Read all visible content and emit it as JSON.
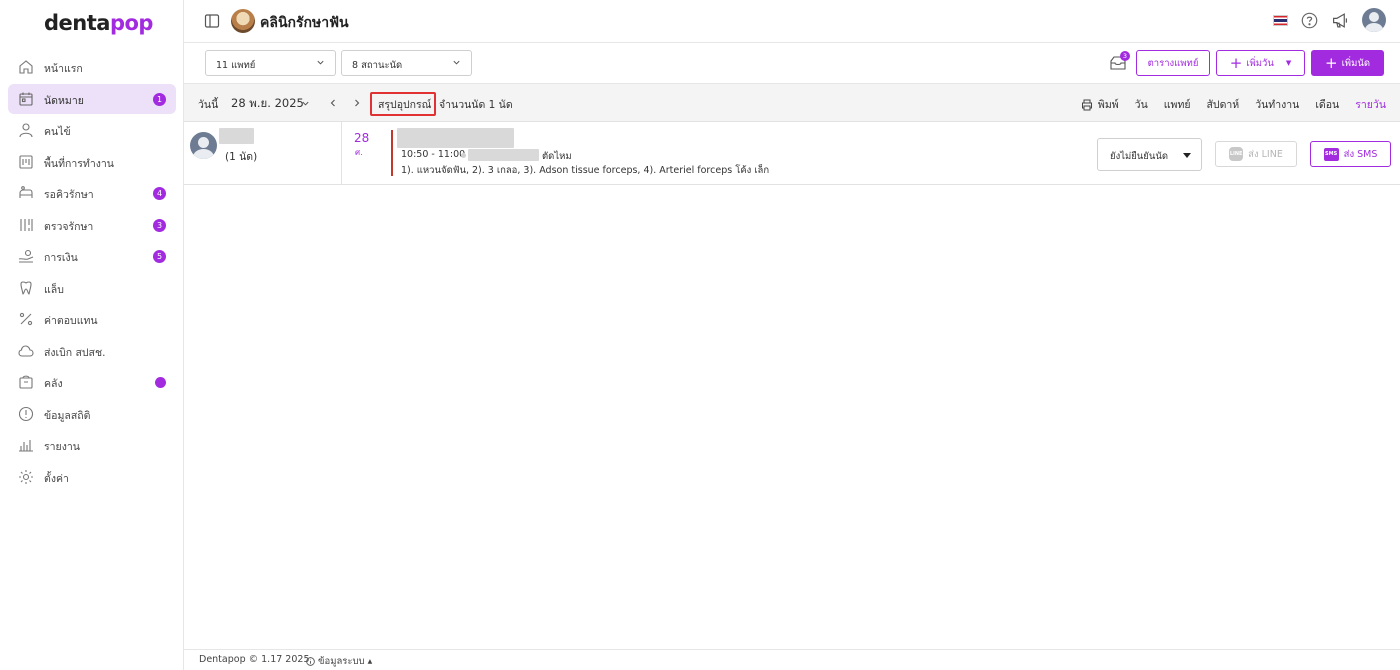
{
  "brand": {
    "logo_main": "denta",
    "logo_accent": "pop",
    "accent_color": "#a22be0"
  },
  "sidebar": {
    "items": [
      {
        "label": "หน้าแรก",
        "icon": "home-icon",
        "active": false
      },
      {
        "label": "นัดหมาย",
        "icon": "calendar-icon",
        "active": true,
        "badge": "1"
      },
      {
        "label": "คนไข้",
        "icon": "user-icon",
        "active": false
      },
      {
        "label": "พื้นที่การทำงาน",
        "icon": "workspace-icon",
        "active": false
      },
      {
        "label": "รอคิวรักษา",
        "icon": "queue-icon",
        "active": false,
        "badge": "4"
      },
      {
        "label": "ตรวจรักษา",
        "icon": "treatment-icon",
        "active": false,
        "badge": "3"
      },
      {
        "label": "การเงิน",
        "icon": "finance-icon",
        "active": false,
        "badge": "5"
      },
      {
        "label": "แล็บ",
        "icon": "tooth-icon",
        "active": false
      },
      {
        "label": "ค่าตอบแทน",
        "icon": "percent-icon",
        "active": false
      },
      {
        "label": "ส่งเบิก สปสช.",
        "icon": "cloud-icon",
        "active": false
      },
      {
        "label": "คลัง",
        "icon": "inventory-icon",
        "active": false,
        "dot": true
      },
      {
        "label": "ข้อมูลสถิติ",
        "icon": "statistics-icon",
        "active": false
      },
      {
        "label": "รายงาน",
        "icon": "report-icon",
        "active": false
      },
      {
        "label": "ตั้งค่า",
        "icon": "gear-icon",
        "active": false
      }
    ]
  },
  "header": {
    "clinic_name": "คลินิกรักษาฟัน"
  },
  "filters": {
    "doctor_select": "11 แพทย์",
    "location_select": "8 สถานะนัด",
    "inbox_count": "3",
    "doctor_schedule_button": "ตารางแพทย์",
    "add_day_button": "เพิ่มวัน",
    "add_appointment_button": "เพิ่มนัด"
  },
  "date_bar": {
    "today": "วันนี้",
    "date": "28 พ.ย. 2025",
    "summary_button": "สรุปอุปกรณ์",
    "count_text": "จำนวนนัด 1 นัด",
    "print": "พิมพ์",
    "views": [
      "วัน",
      "แพทย์",
      "สัปดาห์",
      "วันทำงาน",
      "เดือน",
      "รายวัน"
    ],
    "selected_view": "รายวัน"
  },
  "appointment": {
    "doctor_count": "(1 นัด)",
    "day_number": "28",
    "day_abbr": "ศ.",
    "time": "10:50 - 11:00",
    "procedure": "ตัดไหม",
    "equipment": "1). แหวนจัดฟัน, 2). 3 เกลอ, 3). Adson tissue forceps, 4). Arteriel forceps โค้ง เล็ก",
    "status_select": "ยังไม่ยืนยันนัด",
    "line_button": "ส่ง LINE",
    "sms_button": "ส่ง SMS"
  },
  "footer": {
    "copyright": "Dentapop © 1.17 2025",
    "system_info": "ข้อมูลระบบ"
  }
}
